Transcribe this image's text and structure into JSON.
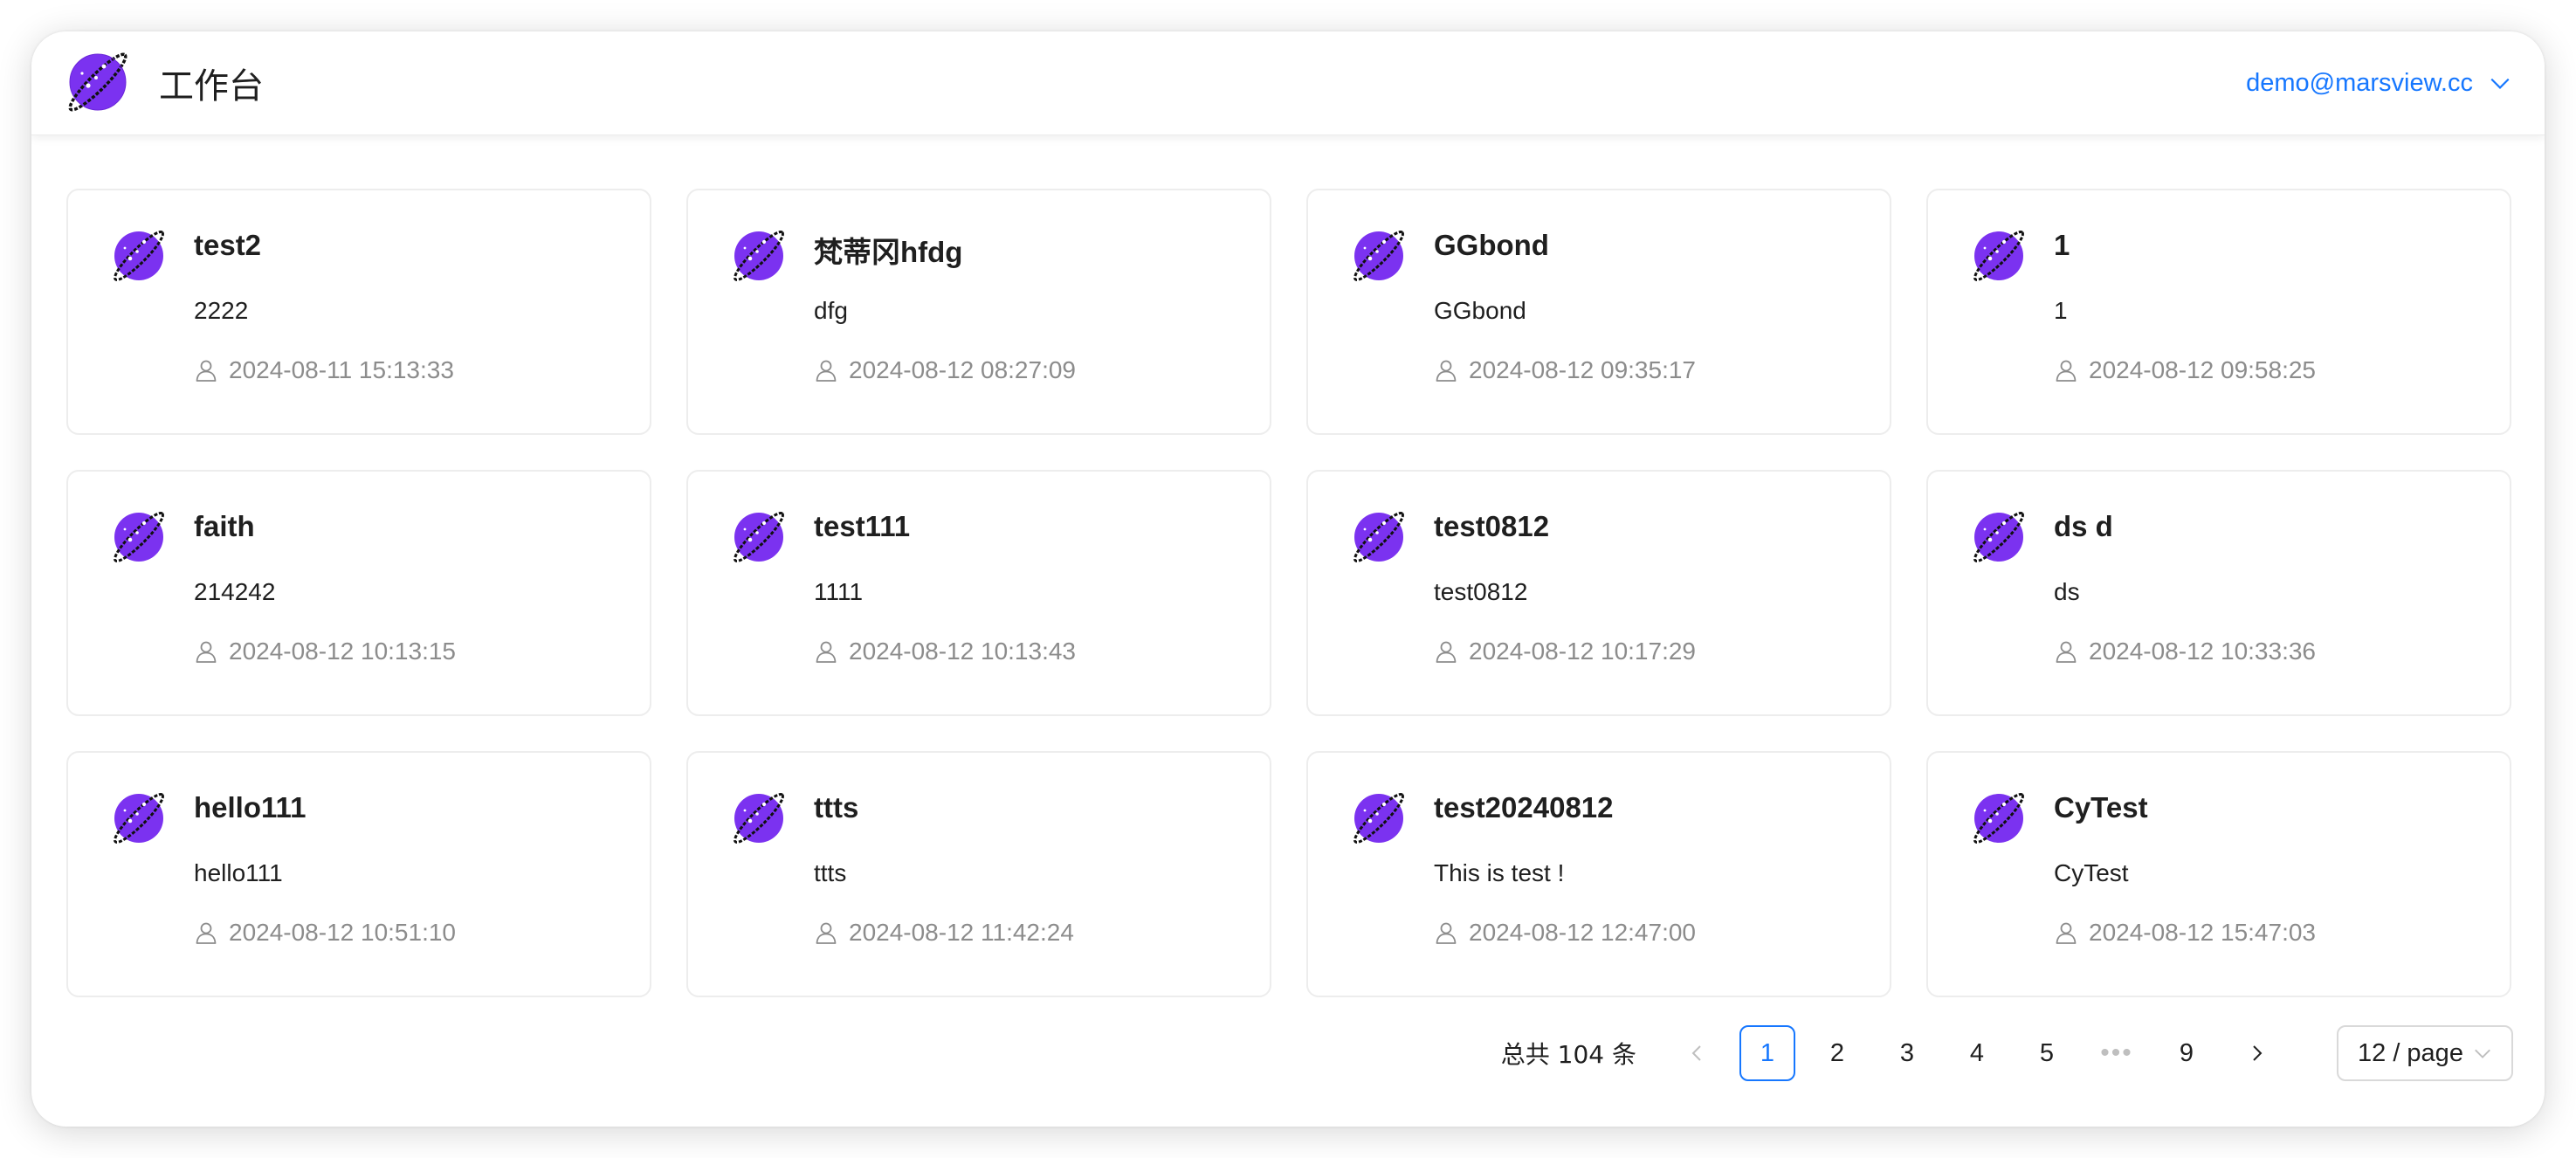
{
  "header": {
    "title": "工作台",
    "user_email": "demo@marsview.cc",
    "logo_icon": "planet-logo-icon",
    "dropdown_icon": "chevron-down-icon"
  },
  "colors": {
    "accent": "#1677ff",
    "logo_purple": "#7b32f0",
    "muted_text": "#8c8c8c",
    "card_border": "#ededed"
  },
  "projects": [
    {
      "name": "test2",
      "description": "2222",
      "created_at": "2024-08-11 15:13:33"
    },
    {
      "name": "梵蒂冈hfdg",
      "description": "dfg",
      "created_at": "2024-08-12 08:27:09"
    },
    {
      "name": "GGbond",
      "description": "GGbond",
      "created_at": "2024-08-12 09:35:17"
    },
    {
      "name": "1",
      "description": "1",
      "created_at": "2024-08-12 09:58:25"
    },
    {
      "name": "faith",
      "description": "214242",
      "created_at": "2024-08-12 10:13:15"
    },
    {
      "name": "test111",
      "description": "1111",
      "created_at": "2024-08-12 10:13:43"
    },
    {
      "name": "test0812",
      "description": "test0812",
      "created_at": "2024-08-12 10:17:29"
    },
    {
      "name": "ds d",
      "description": "ds",
      "created_at": "2024-08-12 10:33:36"
    },
    {
      "name": "hello111",
      "description": "hello111",
      "created_at": "2024-08-12 10:51:10"
    },
    {
      "name": "ttts",
      "description": "ttts",
      "created_at": "2024-08-12 11:42:24"
    },
    {
      "name": "test20240812",
      "description": "This is test !",
      "created_at": "2024-08-12 12:47:00"
    },
    {
      "name": "CyTest",
      "description": "CyTest",
      "created_at": "2024-08-12 15:47:03"
    }
  ],
  "pagination": {
    "total_text": "总共 104 条",
    "current_page": "1",
    "pages": [
      "1",
      "2",
      "3",
      "4",
      "5"
    ],
    "ellipsis": "•••",
    "last_page": "9",
    "page_size": "12 / page"
  }
}
